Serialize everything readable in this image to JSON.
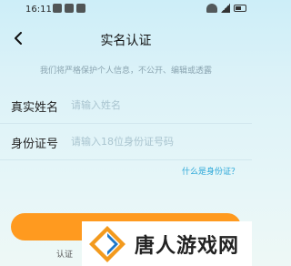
{
  "status_bar": {
    "time": "16:11"
  },
  "nav": {
    "title": "实名认证",
    "back_icon": "chevron-left-icon"
  },
  "notice": "我们将严格保护个人信息，不公开、编辑或透露",
  "form": {
    "name": {
      "label": "真实姓名",
      "placeholder": "请输入姓名"
    },
    "id": {
      "label": "身份证号",
      "placeholder": "请输入18位身份证号码"
    }
  },
  "what_is_id_link": "什么是身份证？",
  "submit": {
    "label": ""
  },
  "agreement_partial": "认证",
  "watermark": {
    "text": "唐人游戏网"
  },
  "colors": {
    "accent": "#ff9a1f",
    "link": "#2aa7d8",
    "background": "#dcf2f8"
  }
}
